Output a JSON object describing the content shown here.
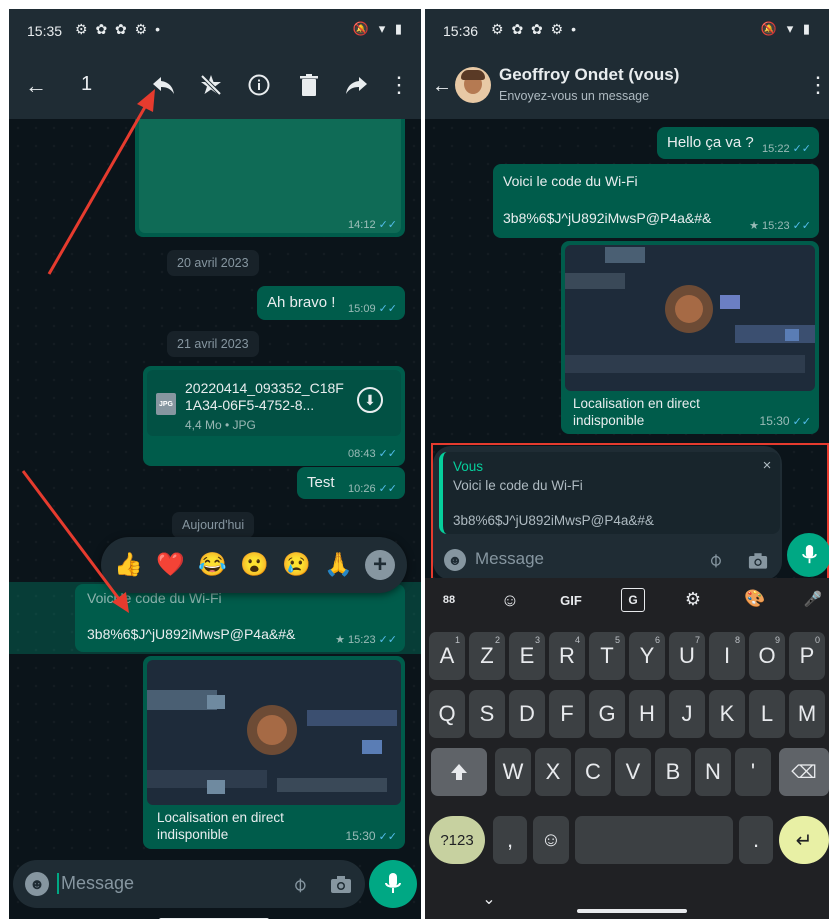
{
  "left": {
    "status": {
      "time": "15:35",
      "notif_icons": "⚙ ✿ ✿ ⚙ •",
      "sys_icons": "🔕 ▾ ▮"
    },
    "selection_bar": {
      "count": "1"
    },
    "messages": {
      "image1_time": "14:12",
      "date1": "20 avril 2023",
      "msg1_text": "Ah bravo !",
      "msg1_time": "15:09",
      "date2": "21 avril 2023",
      "file_name": "20220414_093352_C18F1A34-06F5-4752-8...",
      "file_badge": "JPG",
      "file_meta": "4,4 Mo • JPG",
      "file_time": "08:43",
      "msg2_text": "Test",
      "msg2_time": "10:26",
      "date3": "Aujourd'hui",
      "reactions": [
        "👍",
        "❤️",
        "😂",
        "😮",
        "😢",
        "🙏"
      ],
      "sel_line1": "Voici le code du Wi-Fi",
      "sel_line2": "3b8%6$J^jU892iMwsP@P4a&#&",
      "sel_time": "15:23",
      "loc_line1": "Localisation en direct",
      "loc_line2": "indisponible",
      "loc_time": "15:30"
    },
    "input": {
      "placeholder": "Message"
    }
  },
  "right": {
    "status": {
      "time": "15:36",
      "notif_icons": "⚙ ✿ ✿ ⚙ •",
      "sys_icons": "🔕 ▾ ▮"
    },
    "header": {
      "name": "Geoffroy Ondet (vous)",
      "subtitle": "Envoyez-vous un message"
    },
    "messages": {
      "msg1_text": "Hello ça va ?",
      "msg1_time": "15:22",
      "code_line1": "Voici le code du Wi-Fi",
      "code_line2": "3b8%6$J^jU892iMwsP@P4a&#&",
      "code_time": "15:23",
      "loc_line1": "Localisation en direct",
      "loc_line2": "indisponible",
      "loc_time": "15:30"
    },
    "reply": {
      "author": "Vous",
      "line1": "Voici le code du Wi-Fi",
      "line2": "3b8%6$J^jU892iMwsP@P4a&#&"
    },
    "input": {
      "placeholder": "Message"
    },
    "keyboard": {
      "toolbar": [
        "88",
        "☺",
        "GIF",
        "G",
        "⚙",
        "🎨",
        "🎤"
      ],
      "row1": [
        {
          "k": "A",
          "s": "1"
        },
        {
          "k": "Z",
          "s": "2"
        },
        {
          "k": "E",
          "s": "3"
        },
        {
          "k": "R",
          "s": "4"
        },
        {
          "k": "T",
          "s": "5"
        },
        {
          "k": "Y",
          "s": "6"
        },
        {
          "k": "U",
          "s": "7"
        },
        {
          "k": "I",
          "s": "8"
        },
        {
          "k": "O",
          "s": "9"
        },
        {
          "k": "P",
          "s": "0"
        }
      ],
      "row2": [
        "Q",
        "S",
        "D",
        "F",
        "G",
        "H",
        "J",
        "K",
        "L",
        "M"
      ],
      "row3": [
        "W",
        "X",
        "C",
        "V",
        "B",
        "N",
        "'"
      ],
      "sym": "?123",
      "comma": ",",
      "period": "."
    }
  },
  "colors": {
    "accent": "#00a884",
    "bubble": "#005c4b",
    "annotation": "#e63b2e",
    "ticks": "#53bdeb"
  }
}
